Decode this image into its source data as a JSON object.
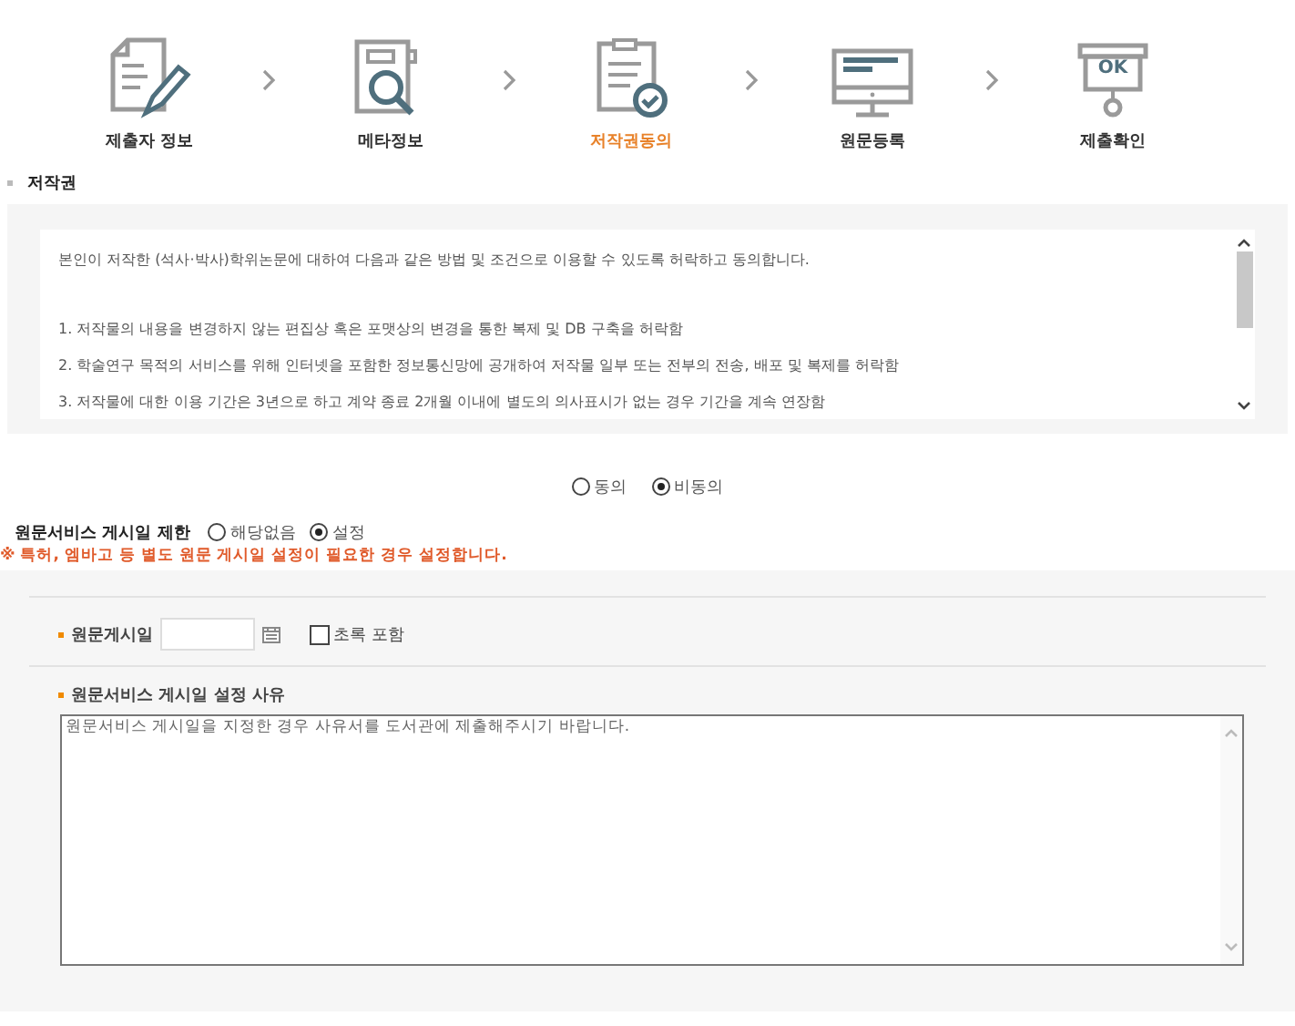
{
  "steps": [
    {
      "label": "제출자 정보",
      "kind": "pen",
      "selected": false
    },
    {
      "label": "메타정보",
      "kind": "search",
      "selected": false
    },
    {
      "label": "저작권동의",
      "kind": "check",
      "selected": true
    },
    {
      "label": "원문등록",
      "kind": "monitor",
      "selected": false
    },
    {
      "label": "제출확인",
      "kind": "ok",
      "icon_text": "OK",
      "selected": false
    }
  ],
  "section_title": "저작권",
  "terms": {
    "lines": [
      "본인이 저작한 (석사·박사)학위논문에 대하여 다음과 같은 방법 및 조건으로 이용할 수 있도록 허락하고 동의합니다.",
      "1. 저작물의 내용을 변경하지 않는 편집상 혹은 포맷상의 변경을 통한 복제 및 DB 구축을 허락함",
      "2. 학술연구 목적의 서비스를 위해 인터넷을 포함한 정보통신망에 공개하여 저작물 일부 또는 전부의 전송, 배포 및 복제를 허락함",
      "3. 저작물에 대한 이용 기간은 3년으로 하고 계약 종료 2개월 이내에 별도의 의사표시가 없는 경우 기간을 계속 연장함"
    ]
  },
  "consent_options": [
    {
      "label": "동의",
      "selected": false
    },
    {
      "label": "비동의",
      "selected": true
    }
  ],
  "restriction": {
    "title": "원문서비스 게시일 제한",
    "options": [
      {
        "label": "해당없음",
        "selected": false
      },
      {
        "label": "설정",
        "selected": true
      }
    ],
    "note": "※ 특허, 엠바고 등 별도 원문 게시일 설정이 필요한 경우 설정합니다."
  },
  "post_date": {
    "label": "원문게시일",
    "checkbox": {
      "label": "초록 포함",
      "checked": false
    }
  },
  "reason": {
    "label": "원문서비스 게시일 설정 사유",
    "value": "원문서비스 게시일을 지정한 경우 사유서를 도서관에 제출해주시기 바랍니다."
  }
}
